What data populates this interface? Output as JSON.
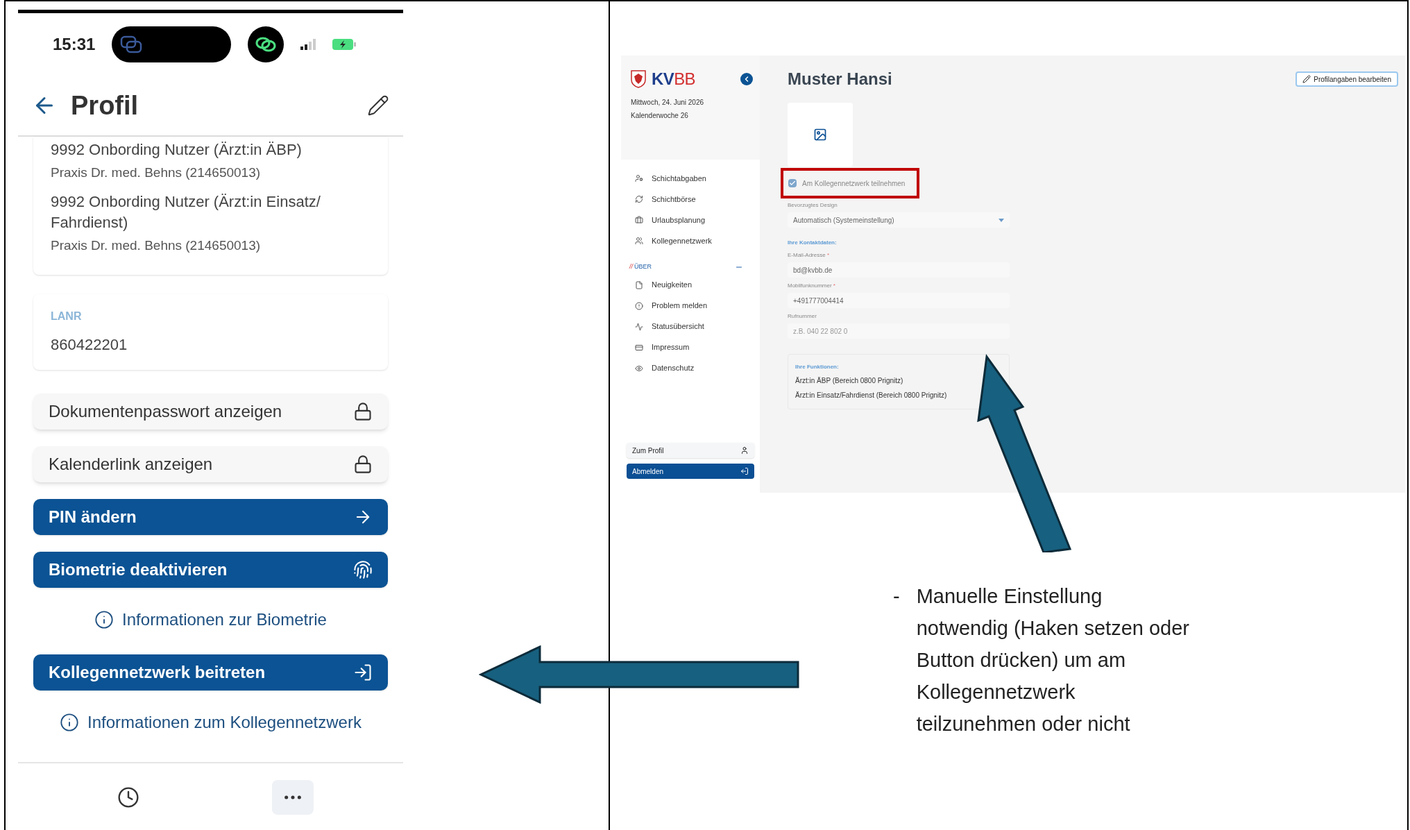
{
  "phone": {
    "status_bar": {
      "time": "15:31"
    },
    "header": {
      "title": "Profil"
    },
    "roles": [
      {
        "name": "9992 Onbording Nutzer (Ärzt:in ÄBP)",
        "practice": "Praxis Dr. med. Behns (214650013)"
      },
      {
        "name": "9992 Onbording Nutzer (Ärzt:in Einsatz/ Fahrdienst)",
        "practice": "Praxis Dr. med. Behns (214650013)"
      }
    ],
    "lanr": {
      "label": "LANR",
      "value": "860422201"
    },
    "actions": [
      {
        "kind": "secondary",
        "label": "Dokumentenpasswort anzeigen"
      },
      {
        "kind": "secondary",
        "label": "Kalenderlink anzeigen"
      },
      {
        "kind": "primary",
        "label": "PIN ändern"
      },
      {
        "kind": "primary",
        "label": "Biometrie deaktivieren"
      },
      {
        "kind": "info",
        "label": "Informationen zur Biometrie"
      },
      {
        "kind": "primary",
        "label": "Kollegennetzwerk beitreten"
      },
      {
        "kind": "info",
        "label": "Informationen zum Kollegennetzwerk"
      }
    ],
    "bottom_nav": [
      {
        "selected": false
      },
      {
        "selected": true
      }
    ]
  },
  "web": {
    "logo": [
      "KV",
      "BB"
    ],
    "date": "Mittwoch, 24. Juni 2026",
    "week": "Kalenderwoche 26",
    "nav_groups": [
      {
        "items": [
          "Schichtabgaben",
          "Schichtbörse",
          "Urlaubsplanung",
          "Kollegennetzwerk"
        ]
      },
      {
        "prefix": "//",
        "heading": "ÜBER",
        "expanded": true,
        "items": [
          "Neuigkeiten",
          "Problem melden",
          "Statusübersicht",
          "Impressum",
          "Datenschutz"
        ]
      }
    ],
    "sidebar_buttons": [
      {
        "kind": "secondary",
        "label": "Zum Profil"
      },
      {
        "kind": "primary",
        "label": "Abmelden"
      }
    ],
    "title": "Muster Hansi",
    "edit_button": "Profilangaben bearbeiten",
    "network_checkbox": {
      "label": "Am Kollegennetzwerk teilnehmen",
      "checked": true
    },
    "design": {
      "label": "Bevorzugtes Design",
      "value": "Automatisch (Systemeinstellung)"
    },
    "contact_heading": "Ihre Kontaktdaten:",
    "fields": [
      {
        "label": "E-Mail-Adresse",
        "required_mark": "*",
        "value": "bd@kvbb.de"
      },
      {
        "label": "Mobilfunknummer",
        "required_mark": "*",
        "value": "+491777004414"
      },
      {
        "label": "Rufnummer",
        "placeholder": "z.B. 040 22 802 0"
      }
    ],
    "functions": {
      "heading": "Ihre Funktionen:",
      "items": [
        "Ärzt:in ÄBP (Bereich 0800 Prignitz)",
        "Ärzt:in Einsatz/Fahrdienst (Bereich 0800 Prignitz)"
      ]
    }
  },
  "annotation": {
    "bullet": "-",
    "lines": [
      "Manuelle Einstellung",
      "notwendig (Haken setzen oder",
      "Button drücken) um am",
      "Kollegennetzwerk",
      "teilzunehmen oder nicht"
    ]
  }
}
